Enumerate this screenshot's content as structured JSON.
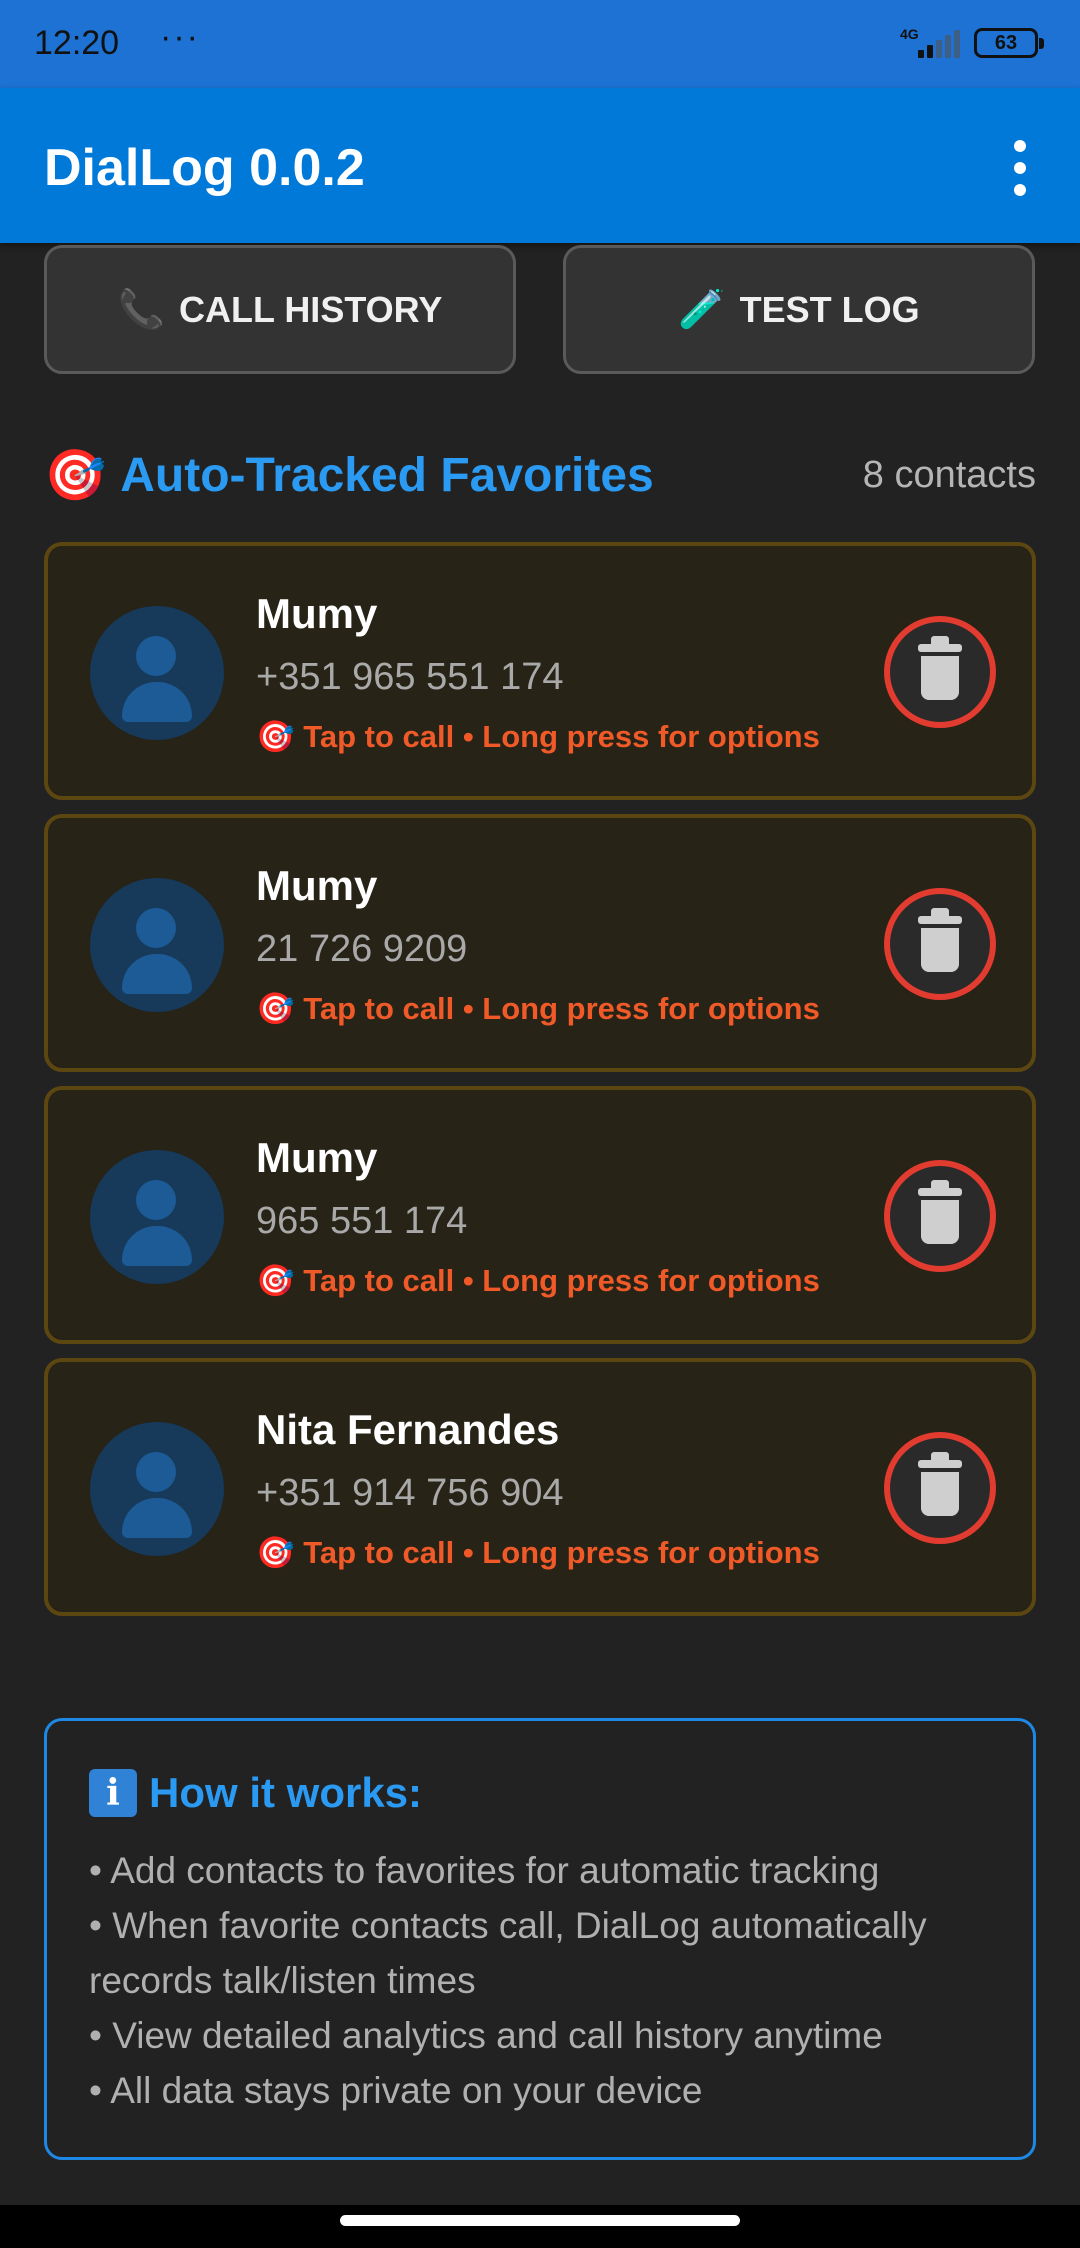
{
  "status_bar": {
    "time": "12:20",
    "dots": "···",
    "network": "4G",
    "battery": "63"
  },
  "app_bar": {
    "title": "DialLog 0.0.2",
    "menu_icon": "more-vert-icon"
  },
  "buttons": {
    "call_history": {
      "icon": "📞",
      "label": "CALL HISTORY"
    },
    "test_log": {
      "icon": "🧪",
      "label": "TEST LOG"
    }
  },
  "favorites": {
    "icon": "🎯",
    "title": "Auto-Tracked Favorites",
    "count": "8 contacts",
    "items": [
      {
        "name": "Mumy",
        "phone": "+351 965 551 174",
        "hint": "🎯 Tap to call • Long press for options"
      },
      {
        "name": "Mumy",
        "phone": "21 726 9209",
        "hint": "🎯 Tap to call • Long press for options"
      },
      {
        "name": "Mumy",
        "phone": "965 551 174",
        "hint": "🎯 Tap to call • Long press for options"
      },
      {
        "name": "Nita Fernandes",
        "phone": "+351 914 756 904",
        "hint": "🎯 Tap to call • Long press for options"
      }
    ]
  },
  "info": {
    "icon": "i",
    "title": "How it works:",
    "lines": [
      "• Add contacts to favorites for automatic tracking",
      "• When favorite contacts call, DialLog automatically records talk/listen times",
      "• View detailed analytics and call history anytime",
      "• All data stays private on your device"
    ]
  },
  "colors": {
    "status_bar": "#1d72d4",
    "app_bar": "#0079d8",
    "background": "#222222",
    "accent_blue": "#2b9af3",
    "hint_orange": "#f05a28",
    "delete_red": "#e23b30",
    "card_border": "#5d4711"
  }
}
